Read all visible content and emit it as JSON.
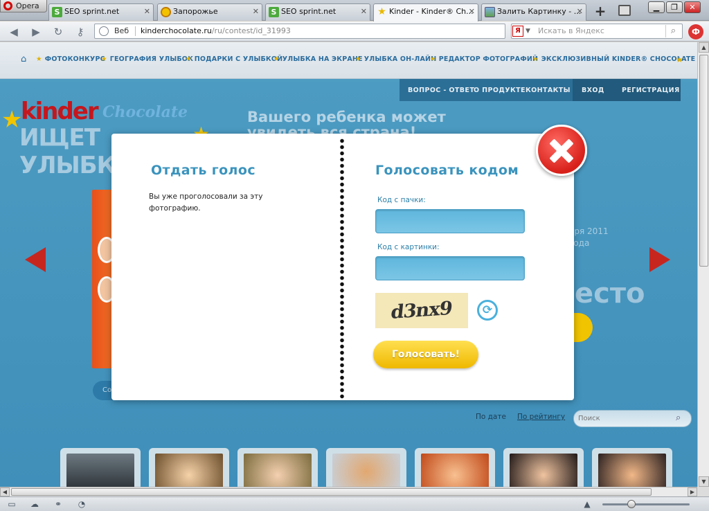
{
  "browser": {
    "menu_label": "Opera",
    "tabs": [
      {
        "title": "SEO sprint.net",
        "icon": "seo-sprint-icon",
        "active": false
      },
      {
        "title": "Запорожье",
        "icon": "sun-icon",
        "active": false
      },
      {
        "title": "SEO sprint.net",
        "icon": "seo-sprint-icon",
        "active": false
      },
      {
        "title": "Kinder - Kinder® Ch...",
        "icon": "star-icon",
        "active": true
      },
      {
        "title": "Залить Картинку - ...",
        "icon": "image-icon",
        "active": false
      }
    ],
    "address": {
      "label": "Веб",
      "host": "kinderchocolate.ru",
      "path": "/ru/contest/id_31993"
    },
    "search": {
      "engine_badge": "Я",
      "placeholder": "Искать в Яндекс"
    },
    "user_badge": "Ф",
    "status_zoom": 0.33
  },
  "site": {
    "nav": [
      "ФОТОКОНКУРС",
      "ГЕОГРАФИЯ УЛЫБОК",
      "ПОДАРКИ С УЛЫБКОЙ",
      "УЛЫБКА НА ЭКРАНЕ",
      "УЛЫБКА ОН-ЛАЙН",
      "РЕДАКТОР ФОТОГРАФИЙ",
      "ЭКСКЛЮЗИВНЫЙ KINDER® CHOCOLATE"
    ],
    "top_menu": {
      "faq": "ВОПРОС - ОТВЕТ",
      "about": "О ПРОДУКТЕ",
      "contacts": "КОНТАКТЫ",
      "login": "ВХОД",
      "register": "РЕГИСТРАЦИЯ"
    },
    "logo": {
      "brand": "kinder",
      "sub": "Chocolate",
      "slogan": "ИЩЕТ УЛЫБКИ"
    },
    "tagline_1": "Вашего ребенка может",
    "tagline_2": "увидеть вся страна!",
    "side_text_1": "бря 2011",
    "side_text_2": "года",
    "big_text": "есто",
    "left_button_peek": "Со",
    "sort_by_date": "По дате",
    "sort_by_rating": "По рейтингу",
    "site_search_placeholder": "Поиск"
  },
  "modal": {
    "left_title": "Отдать голос",
    "left_message": "Вы уже проголосовали за эту фотографию.",
    "right_title": "Голосовать кодом",
    "pack_code_label": "Код с пачки:",
    "image_code_label": "Код с картинки:",
    "captcha_text": "d3nx9",
    "submit_label": "Голосовать!"
  },
  "colors": {
    "accent_blue": "#3a93bd",
    "button_yellow": "#efb800",
    "close_red": "#d8201a",
    "brand_red": "#c5161d"
  }
}
